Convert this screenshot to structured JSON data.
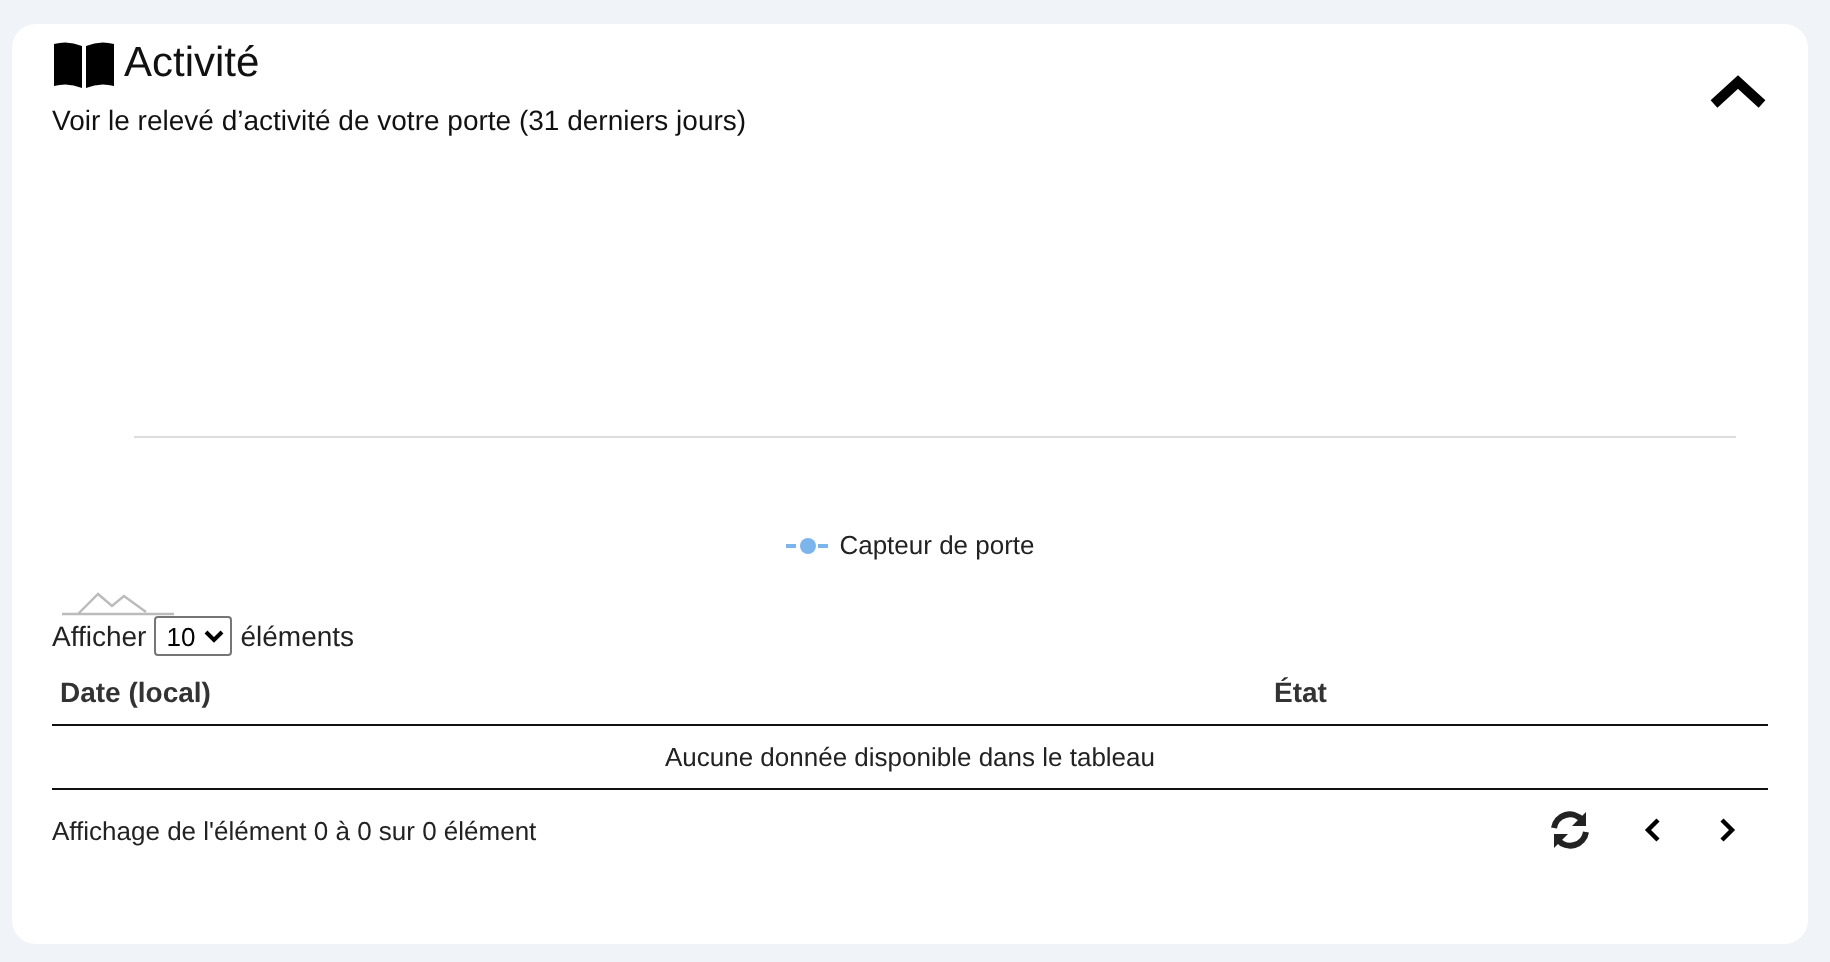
{
  "panel": {
    "title": "Activité",
    "subtitle": "Voir le relevé d’activité de votre porte (31 derniers jours)",
    "expanded": true
  },
  "chart": {
    "legend": [
      {
        "name": "Capteur de porte",
        "color": "#7cb5ec"
      }
    ]
  },
  "table": {
    "length_label_before": "Afficher",
    "page_size": "10",
    "length_label_after": "éléments",
    "columns": [
      "Date (local)",
      "État"
    ],
    "empty_message": "Aucune donnée disponible dans le tableau",
    "info": "Affichage de l'élément 0 à 0 sur 0 élément",
    "prev_disabled": false,
    "next_disabled": false
  }
}
